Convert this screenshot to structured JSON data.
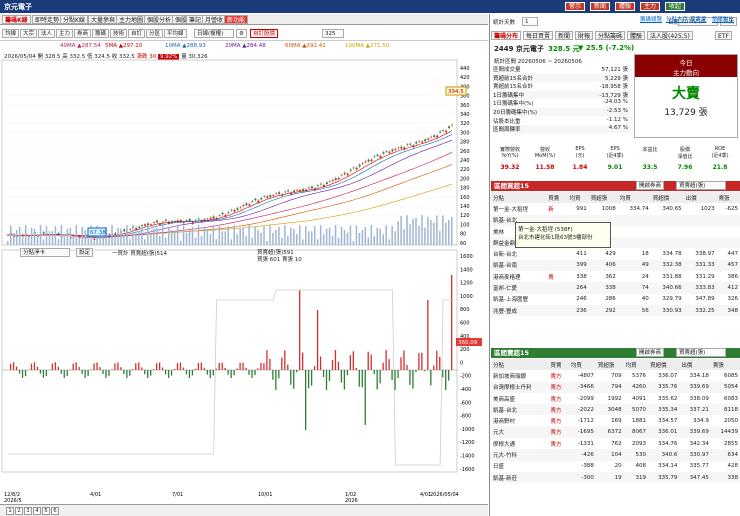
{
  "window": {
    "title": "京元電子",
    "top_buttons": [
      "警示",
      "新聞",
      "體驗",
      "主力",
      "收起"
    ]
  },
  "tabs": [
    "籌碼K線",
    "即時走勢",
    "分點K線",
    "大量參與",
    "主力地圖",
    "個股分析",
    "個股",
    "筆記",
    "月營收",
    "新功能"
  ],
  "toolbar": {
    "buttons": [
      "均線",
      "大宗",
      "法人",
      "主力",
      "券商",
      "籌碼",
      "技術",
      "自訂",
      "分區",
      "平均線",
      "日週月"
    ],
    "period": "日線(複權)",
    "count": "325",
    "stock_search": "自訂股價"
  },
  "ma_legend": [
    {
      "label": "5MA",
      "value": "297.10",
      "color": "#c00"
    },
    {
      "label": "10MA",
      "value": "288.93",
      "color": "#1565c0"
    },
    {
      "label": "20MA",
      "value": "284.48",
      "color": "#6a1b9a"
    },
    {
      "label": "60MA",
      "value": "292.41",
      "color": "#d35400"
    },
    {
      "label": "100MA",
      "value": "271.50",
      "color": "#d4a000"
    },
    {
      "label": "40MA",
      "value": "287.54",
      "color": "#c2185b"
    }
  ],
  "quote_line": {
    "date": "2026/05/04",
    "open": "開 328.5",
    "high": "高 332.5",
    "low": "低 324.5",
    "close": "收 332.5",
    "change": "漲跌 30",
    "pct": "9.92%",
    "vol": "量 30,326"
  },
  "price_axis": [
    "440",
    "420",
    "400",
    "380",
    "360",
    "340",
    "320",
    "300",
    "280",
    "260",
    "240",
    "220",
    "200",
    "180",
    "160",
    "140",
    "120",
    "100",
    "80",
    "60"
  ],
  "price_marks": {
    "high": "394.5",
    "low": "67.38"
  },
  "volume_axis_labels": [
    "1600",
    "1400",
    "1200",
    "1000",
    "800",
    "600",
    "400",
    "200",
    "0",
    "-200",
    "-400",
    "-600",
    "-800",
    "-1000",
    "-1200",
    "-1400",
    "-1600"
  ],
  "sub_indicator": {
    "select": "分點淨卡",
    "btn": "設定",
    "legend1": "一買計 買賣超(張)514",
    "legend2": "買賣超(張)591",
    "legend3": "買張 601 賣張 10",
    "current": "360.09"
  },
  "date_axis": [
    "12/8/2\n2026/5",
    "4/01",
    "7/01",
    "10/01",
    "1/02\n2026",
    "4/01",
    "2026/05/04"
  ],
  "range_buttons": [
    "1月",
    "6月",
    "1年",
    "3年"
  ],
  "pages": [
    "1",
    "2",
    "3",
    "4",
    "5",
    "6"
  ],
  "right": {
    "date_label": "統計天數",
    "days": "1",
    "date_icon": "日期",
    "date": "2026/5/6",
    "today_btn": "今天",
    "links": [
      "籌碼總覽",
      "分點大戶",
      "買賣差",
      "整體對比"
    ],
    "tabs": [
      "籌碼分布",
      "每日買賣",
      "新聞",
      "財報",
      "分點籌碼",
      "體驗",
      "法人股(425,5)",
      "ETF"
    ],
    "stock_line": "2449 京元電子",
    "price": "328.5 元",
    "change": "▼ 25.5 (-7.2%)",
    "stats_title": "統計區間 20260506 ~ 20260506",
    "stats": [
      [
        "區間成交量",
        "57,121 張"
      ],
      [
        "買超前15名合計",
        "5,229 張"
      ],
      [
        "賣超前15名合計",
        "-18,958 張"
      ],
      [
        "1日籌碼集中",
        "-13,729 張"
      ],
      [
        "1日籌碼集中(%)",
        "-24.03 %"
      ],
      [
        "20日籌碼集中(%)",
        "-2.53 %"
      ],
      [
        "佔股本比重",
        "-1.12 %"
      ],
      [
        "區間周轉率",
        "4.67 %"
      ]
    ],
    "today_box": {
      "h1": "今日",
      "h2": "主力動向",
      "verdict": "大賣",
      "amount": "13,729 張"
    },
    "fin_headers": [
      "實際營收\nYoY(%)",
      "營收\nMoM(%)",
      "EPS\n(元)",
      "EPS\n(近4季)",
      "本益比",
      "股價\n淨值比",
      "ROE\n(近4季)"
    ],
    "fin_values": [
      "39.32",
      "11.58",
      "1.84",
      "9.01",
      "33.5",
      "7.96",
      "21.8"
    ],
    "buy_title": "區間買超15",
    "buy_select": "開啟券商",
    "buy_sort": "買賣超(張)",
    "buy_cols": [
      "分點",
      "買賣",
      "均買",
      "買超張",
      "均買",
      "買超價",
      "出價",
      "賣張"
    ],
    "buy_rows": [
      [
        "第一金-大稻埕",
        "新",
        "991",
        "1008",
        "334.74",
        "340.65",
        "1023",
        "-625"
      ],
      [
        "凱基-台北",
        "",
        "",
        "",
        "",
        "",
        "",
        ""
      ],
      [
        "美林",
        "",
        "",
        "",
        "",
        "",
        "",
        ""
      ],
      [
        "群益金鼎-高雄",
        "",
        "",
        "",
        "",
        "",
        "",
        ""
      ],
      [
        "台新-台北",
        "",
        "411",
        "429",
        "18",
        "334.78",
        "338.97",
        "447",
        "-255"
      ],
      [
        "凱基-台南",
        "",
        "399",
        "406",
        "49",
        "332.38",
        "331.33",
        "457",
        "-132"
      ],
      [
        "港商麥格理",
        "賣",
        "338",
        "362",
        "24",
        "331.88",
        "331.29",
        "386",
        "-116"
      ],
      [
        "富邦-仁愛",
        "",
        "264",
        "338",
        "74",
        "340.66",
        "333.83",
        "412",
        "-392"
      ],
      [
        "凱基-上海匯豐",
        "",
        "246",
        "286",
        "40",
        "329.79",
        "347.89",
        "326",
        "-81"
      ],
      [
        "兆豐-豐成",
        "",
        "236",
        "292",
        "56",
        "330.93",
        "332.25",
        "348",
        "-62"
      ]
    ],
    "sell_title": "區間賣超15",
    "sell_rows": [
      [
        "新加坡商瑞銀",
        "賣方",
        "-4807",
        "709",
        "5376",
        "336.07",
        "334.18",
        "6085",
        "-2511"
      ],
      [
        "台灣摩根士丹利",
        "賣方",
        "-3466",
        "794",
        "4260",
        "335.76",
        "339.69",
        "5054",
        "-4172"
      ],
      [
        "美商高盛",
        "賣方",
        "-2099",
        "1992",
        "4091",
        "335.62",
        "338.09",
        "6083",
        "-2499"
      ],
      [
        "凱基-台北",
        "賣方",
        "-2022",
        "3048",
        "5070",
        "335.34",
        "337.21",
        "8118",
        "-2339"
      ],
      [
        "港商野村",
        "賣方",
        "-1712",
        "169",
        "1881",
        "334.57",
        "334.9",
        "2050",
        "1068"
      ],
      [
        "元大",
        "賣方",
        "-1695",
        "6372",
        "8067",
        "336.01",
        "339.69",
        "14439",
        "4245"
      ],
      [
        "摩根大通",
        "賣方",
        "-1331",
        "762",
        "2093",
        "334.76",
        "342.34",
        "2855",
        "2419"
      ],
      [
        "元大-竹科",
        "",
        "-426",
        "104",
        "530",
        "340.6",
        "330.97",
        "634",
        "-1"
      ],
      [
        "日盛",
        "",
        "-388",
        "20",
        "408",
        "334.14",
        "335.77",
        "428",
        "283"
      ],
      [
        "凱基-新莊",
        "",
        "-300",
        "19",
        "319",
        "335.79",
        "347.45",
        "338",
        "359"
      ]
    ],
    "tooltip1": "第一金-大稻埕 (538F)",
    "tooltip2": "台北市建化街1段63號3樓部份"
  }
}
